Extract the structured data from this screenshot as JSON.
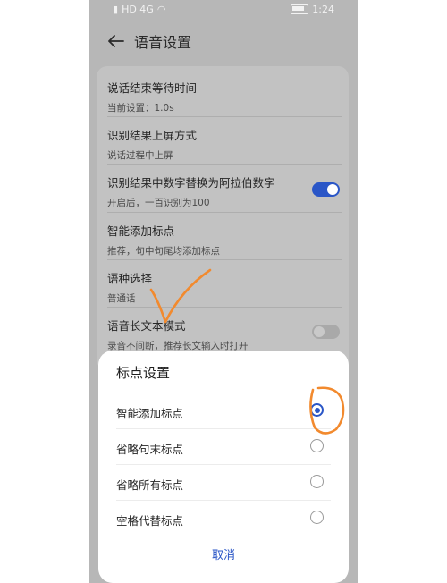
{
  "status_bar": {
    "left_icons": "HD 4G",
    "time": "1:24"
  },
  "header": {
    "title": "语音设置"
  },
  "settings": [
    {
      "title": "说话结束等待时间",
      "subtitle": "当前设置：1.0s"
    },
    {
      "title": "识别结果上屏方式",
      "subtitle": "说话过程中上屏"
    },
    {
      "title": "识别结果中数字替换为阿拉伯数字",
      "subtitle": "开启后，一百识别为100",
      "toggle": true
    },
    {
      "title": "智能添加标点",
      "subtitle": "推荐，句中句尾均添加标点"
    },
    {
      "title": "语种选择",
      "subtitle": "普通话"
    },
    {
      "title": "语音长文本模式",
      "subtitle": "录音不间断，推荐长文输入时打开",
      "toggle": false
    }
  ],
  "sheet": {
    "title": "标点设置",
    "options": [
      {
        "label": "智能添加标点",
        "selected": true
      },
      {
        "label": "省略句末标点",
        "selected": false
      },
      {
        "label": "省略所有标点",
        "selected": false
      },
      {
        "label": "空格代替标点",
        "selected": false
      }
    ],
    "cancel_label": "取消"
  },
  "colors": {
    "accent": "#2a56c7",
    "annotation": "#f28a2e"
  }
}
